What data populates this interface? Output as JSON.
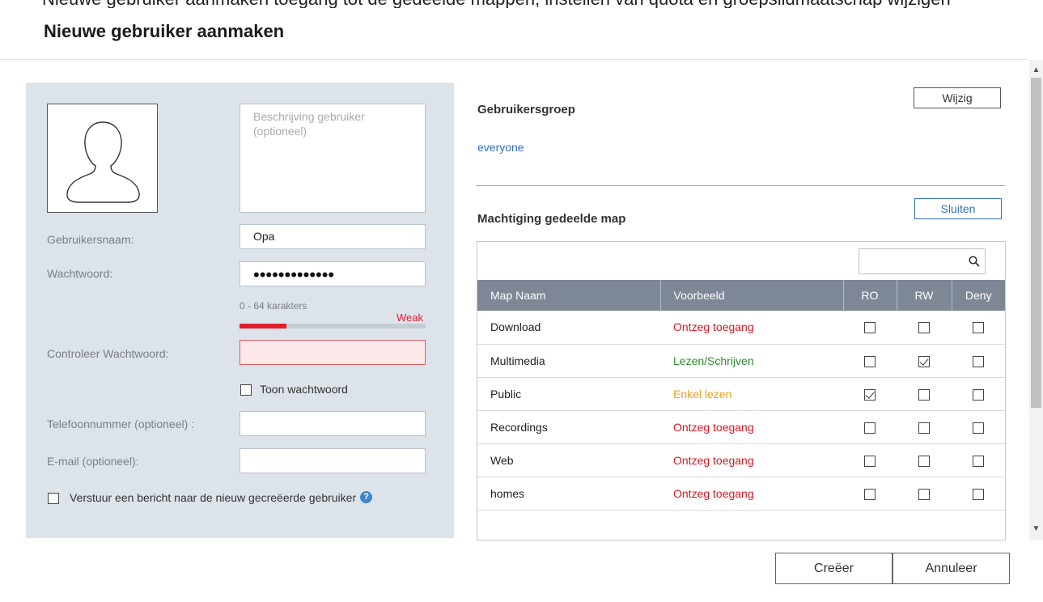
{
  "top_strip_text": "Nieuwe gebruiker aanmaken toegang tot de gedeelde mappen, instellen van quota en groepslidmaatschap wijzigen",
  "dialog": {
    "title": "Nieuwe gebruiker aanmaken"
  },
  "left": {
    "description_placeholder": "Beschrijving gebruiker (optioneel)",
    "username_label": "Gebruikersnaam:",
    "username_value": "Opa",
    "password_label": "Wachtwoord:",
    "password_value": "•••••••••••••",
    "password_hint": "0 - 64 karakters",
    "strength_label": "Weak",
    "strength_level": 0.25,
    "confirm_label": "Controleer Wachtwoord:",
    "confirm_value": "",
    "show_password_label": "Toon wachtwoord",
    "phone_label": "Telefoonnummer (optioneel) :",
    "phone_value": "",
    "email_label": "E-mail (optioneel):",
    "email_value": "",
    "notify_label": "Verstuur een bericht naar de nieuw gecreëerde gebruiker",
    "help_icon": "?"
  },
  "right": {
    "group_title": "Gebruikersgroep",
    "change_button": "Wijzig",
    "group_value": "everyone",
    "permission_title": "Machtiging gedeelde map",
    "close_button": "Sluiten",
    "search_value": "",
    "columns": [
      "Map Naam",
      "Voorbeeld",
      "RO",
      "RW",
      "Deny"
    ],
    "rows": [
      {
        "name": "Download",
        "preview": "Ontzeg toegang",
        "preview_color": "#e0141e",
        "ro": false,
        "rw": false,
        "deny": false
      },
      {
        "name": "Multimedia",
        "preview": "Lezen/Schrijven",
        "preview_color": "#2a8a2a",
        "ro": false,
        "rw": true,
        "deny": false
      },
      {
        "name": "Public",
        "preview": "Enkel lezen",
        "preview_color": "#f0a020",
        "ro": true,
        "rw": false,
        "deny": false
      },
      {
        "name": "Recordings",
        "preview": "Ontzeg toegang",
        "preview_color": "#e0141e",
        "ro": false,
        "rw": false,
        "deny": false
      },
      {
        "name": "Web",
        "preview": "Ontzeg toegang",
        "preview_color": "#e0141e",
        "ro": false,
        "rw": false,
        "deny": false
      },
      {
        "name": "homes",
        "preview": "Ontzeg toegang",
        "preview_color": "#e0141e",
        "ro": false,
        "rw": false,
        "deny": false
      }
    ]
  },
  "footer": {
    "create_button": "Creëer",
    "cancel_button": "Annuleer"
  },
  "icons": {
    "avatar": "user-silhouette-icon",
    "search": "magnifier-icon",
    "help": "question-circle-icon"
  }
}
